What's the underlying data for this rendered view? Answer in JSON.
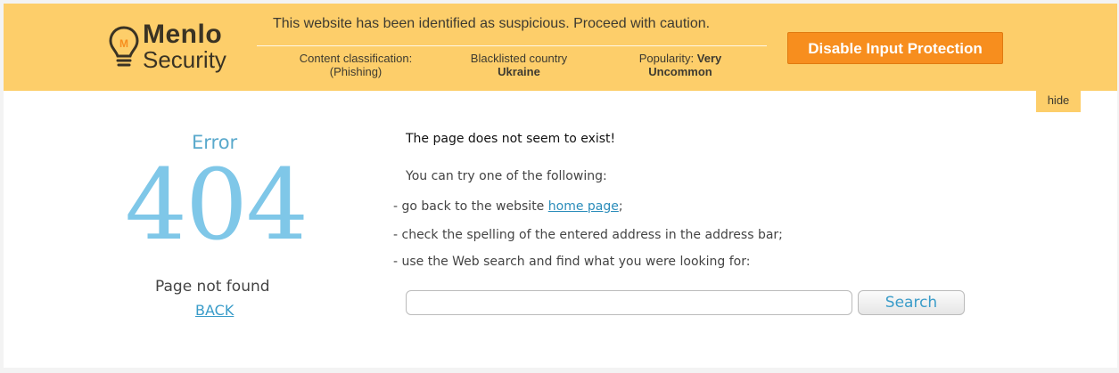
{
  "banner": {
    "logo": {
      "word": "Menlo",
      "sub": "Security",
      "icon": "lightbulb-icon"
    },
    "warning": "This website has been identified as suspicious. Proceed with caution.",
    "classification": {
      "label": "Content classification:",
      "value": "(Phishing)"
    },
    "country": {
      "label": "Blacklisted country",
      "value": "Ukraine"
    },
    "popularity": {
      "label": "Popularity:",
      "value_part1": "Very",
      "value_part2": "Uncommon"
    },
    "disable_label": "Disable Input Protection",
    "hide_label": "hide",
    "colors": {
      "banner_bg": "#fdce6a",
      "button_bg": "#f78e1e"
    }
  },
  "error": {
    "word": "Error",
    "code": "404",
    "not_found": "Page not found",
    "back": "BACK"
  },
  "message": {
    "title": "The page does not seem to exist!",
    "try": "You can try one of the following:",
    "line1_prefix": "- go back to the website",
    "line1_link": "home page",
    "line1_suffix": ";",
    "line2": "- check the spelling of the entered address in the address bar;",
    "line3": "- use the Web search and find what you were looking for:"
  },
  "search": {
    "value": "",
    "button": "Search"
  }
}
